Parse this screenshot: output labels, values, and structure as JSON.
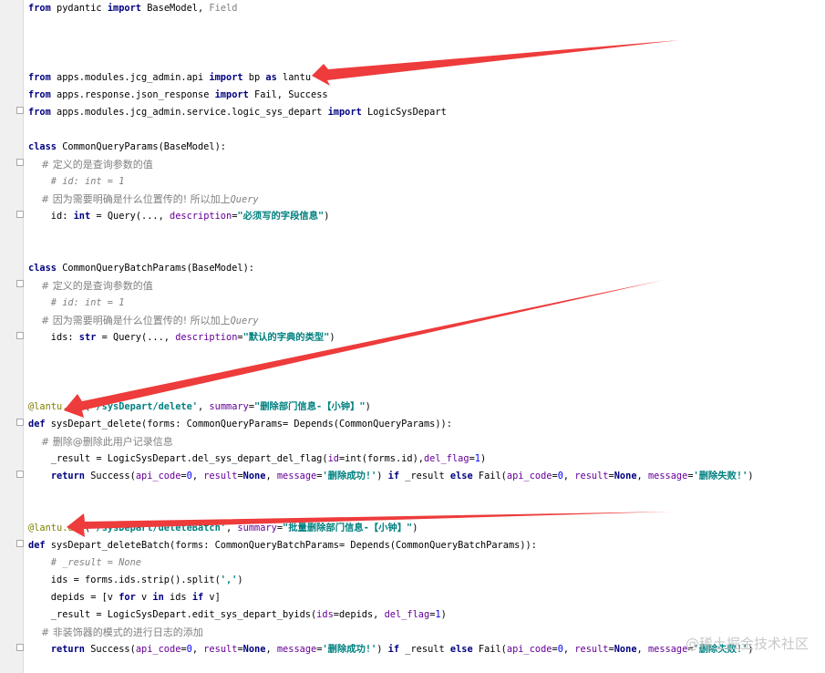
{
  "code": {
    "line1": [
      "from",
      " pydantic ",
      "import",
      " BaseModel, ",
      "Field"
    ],
    "line2": [
      "from",
      " apps.modules.jcg_admin.api ",
      "import",
      " bp ",
      "as",
      " lantu"
    ],
    "line3": [
      "from",
      " apps.response.json_response ",
      "import",
      " Fail, Success"
    ],
    "line4": [
      "from",
      " apps.modules.jcg_admin.service.logic_sys_depart ",
      "import",
      " LogicSysDepart"
    ],
    "line5": [
      "class",
      " CommonQueryParams(BaseModel):"
    ],
    "line6": "    # 定义的是查询参数的值",
    "line7": "    # id: int = 1",
    "line8": [
      "    # 因为需要明确是什么位置传的! 所以加上",
      "Query"
    ],
    "line9": [
      "    id: ",
      "int",
      " = Query(..., ",
      "description",
      "=",
      "\"必须写的字段信息\"",
      ")"
    ],
    "line10": [
      "class",
      " CommonQueryBatchParams(BaseModel):"
    ],
    "line11": "    # 定义的是查询参数的值",
    "line12": "    # id: int = 1",
    "line13": [
      "    # 因为需要明确是什么位置传的! 所以加上",
      "Query"
    ],
    "line14": [
      "    ids: ",
      "str",
      " = Query(..., ",
      "description",
      "=",
      "\"默认的字典的类型\"",
      ")"
    ],
    "line15": [
      "@lantu.",
      "del",
      "(",
      "'/sysDepart/delete'",
      ", ",
      "summary",
      "=",
      "\"删除部门信息-【小钟】\"",
      ")"
    ],
    "line16": [
      "def",
      " sysDepart_delete(forms: CommonQueryParams= Depends(CommonQueryParams)):"
    ],
    "line17": "    # 删除@删除此用户记录信息",
    "line18": [
      "    _result = LogicSysDepart.del_sys_depart_del_flag(",
      "id",
      "=",
      "int",
      "(forms.id),",
      "del_flag",
      "=",
      "1",
      ")"
    ],
    "line19": [
      "    ",
      "return",
      " Success(",
      "api_code",
      "=",
      "0",
      ", ",
      "result",
      "=",
      "None",
      ", ",
      "message",
      "=",
      "'删除成功!'",
      ") ",
      "if",
      " _result ",
      "else",
      " Fail(",
      "api_code",
      "=",
      "0",
      ", ",
      "result",
      "=",
      "None",
      ", ",
      "message",
      "=",
      "'删除失败!'",
      ")"
    ],
    "line20": [
      "@lantu.",
      "del",
      "(",
      "'/sysDepart/deleteBatch'",
      ", ",
      "summary",
      "=",
      "\"批量删除部门信息-【小钟】\"",
      ")"
    ],
    "line21": [
      "def",
      " sysDepart_deleteBatch(forms: CommonQueryBatchParams= Depends(CommonQueryBatchParams)):"
    ],
    "line22": "    # _result = None",
    "line23": [
      "    ids = forms.ids.strip().split(",
      "','",
      ")"
    ],
    "line24": [
      "    depids = [v ",
      "for",
      " v ",
      "in",
      " ids ",
      "if",
      " v]"
    ],
    "line25": [
      "    _result = LogicSysDepart.edit_sys_depart_byids(",
      "ids",
      "=depids, ",
      "del_flag",
      "=",
      "1",
      ")"
    ],
    "line26": "    # 非装饰器的模式的进行日志的添加",
    "line27": [
      "    ",
      "return",
      " Success(",
      "api_code",
      "=",
      "0",
      ", ",
      "result",
      "=",
      "None",
      ", ",
      "message",
      "=",
      "'删除成功!'",
      ") ",
      "if",
      " _result ",
      "else",
      " Fail(",
      "api_code",
      "=",
      "0",
      ", ",
      "result",
      "=",
      "None",
      ", ",
      "message",
      "=",
      "'删除失败!'",
      ")"
    ]
  },
  "watermark": "@稀土掘金技术社区",
  "colors": {
    "arrow": "#ee3b3b",
    "keyword": "#000080",
    "string": "#008080",
    "comment": "#808080",
    "kwarg": "#660099",
    "number": "#0000ff",
    "decorator": "#808000"
  }
}
